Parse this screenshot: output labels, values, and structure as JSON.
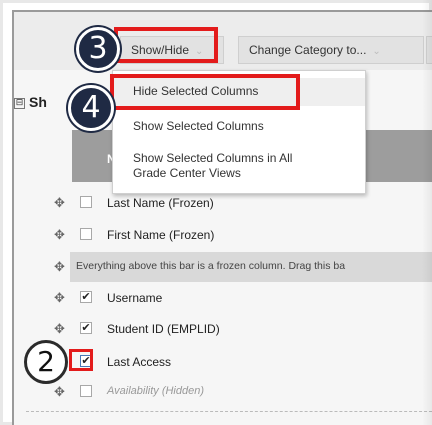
{
  "toolbar": {
    "show_hide_label": "Show/Hide",
    "change_category_label": "Change Category to..."
  },
  "section": {
    "title_partial": "Sh",
    "collapse_symbol": "⊟"
  },
  "header": {
    "first_char": "N"
  },
  "menu": {
    "items": [
      {
        "label": "Hide Selected Columns"
      },
      {
        "label": "Show Selected Columns"
      },
      {
        "label": "Show Selected Columns in All\nGrade Center Views"
      }
    ]
  },
  "rows": [
    {
      "label": "Last Name (Frozen)",
      "checked": false
    },
    {
      "label": "First Name (Frozen)",
      "checked": false
    },
    {
      "label": "Username",
      "checked": true
    },
    {
      "label": "Student ID (EMPLID)",
      "checked": true
    },
    {
      "label": "Last Access",
      "checked": true
    },
    {
      "label": "Availability (Hidden)",
      "checked": false
    }
  ],
  "frozen_note": "Everything above this bar is a frozen column. Drag this ba",
  "steps": {
    "step2": "2",
    "step3": "3",
    "step4": "4"
  },
  "icons": {
    "drag_handle": "move-handle-icon",
    "chevron": "chevron-down-icon",
    "check": "✔"
  },
  "colors": {
    "highlight_red": "#e31b1b",
    "badge_dark": "#1f2a44"
  }
}
